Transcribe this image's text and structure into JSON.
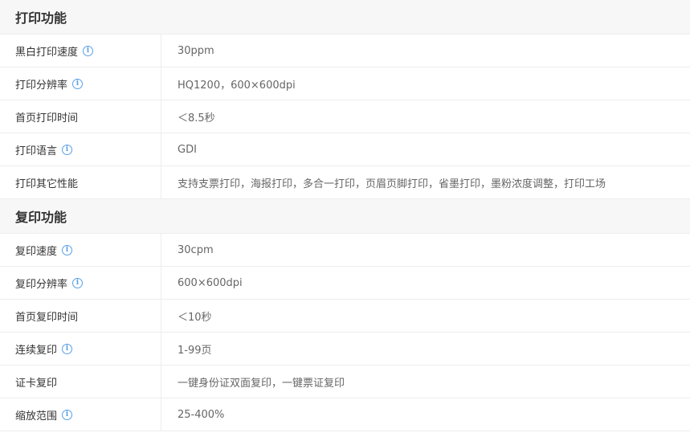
{
  "sections": [
    {
      "title": "打印功能",
      "rows": [
        {
          "label": "黑白打印速度",
          "info": true,
          "value": "30ppm"
        },
        {
          "label": "打印分辨率",
          "info": true,
          "value": "HQ1200，600×600dpi"
        },
        {
          "label": "首页打印时间",
          "info": false,
          "value": "＜8.5秒"
        },
        {
          "label": "打印语言",
          "info": true,
          "value": "GDI"
        },
        {
          "label": "打印其它性能",
          "info": false,
          "value": "支持支票打印，海报打印，多合一打印，页眉页脚打印，省墨打印，墨粉浓度调整，打印工场"
        }
      ]
    },
    {
      "title": "复印功能",
      "rows": [
        {
          "label": "复印速度",
          "info": true,
          "value": "30cpm"
        },
        {
          "label": "复印分辨率",
          "info": true,
          "value": "600×600dpi"
        },
        {
          "label": "首页复印时间",
          "info": false,
          "value": "＜10秒"
        },
        {
          "label": "连续复印",
          "info": true,
          "value": "1-99页"
        },
        {
          "label": "证卡复印",
          "info": false,
          "value": "一键身份证双面复印，一键票证复印"
        },
        {
          "label": "缩放范围",
          "info": true,
          "value": "25-400%"
        }
      ]
    }
  ],
  "icons": {
    "info": "info-icon",
    "info_glyph": "i"
  },
  "colors": {
    "accent": "#5aa0e6",
    "header_bg": "#f7f7f7",
    "border": "#ededed"
  }
}
